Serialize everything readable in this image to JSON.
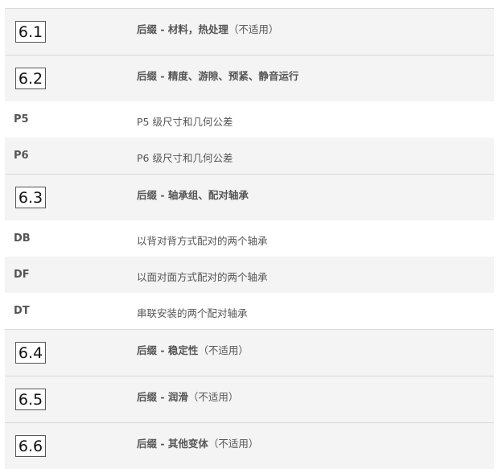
{
  "rows": [
    {
      "type": "section",
      "number": "6.1",
      "title": "后缀 - 材料，热处理",
      "note": "（不适用）"
    },
    {
      "type": "section",
      "number": "6.2",
      "title": "后缀 - 精度、游隙、预紧、静音运行",
      "note": ""
    },
    {
      "type": "item",
      "code": "P5",
      "desc": "P5 级尺寸和几何公差"
    },
    {
      "type": "item",
      "code": "P6",
      "desc": "P6 级尺寸和几何公差"
    },
    {
      "type": "section",
      "number": "6.3",
      "title": "后缀 - 轴承组、配对轴承",
      "note": ""
    },
    {
      "type": "item",
      "code": "DB",
      "desc": "以背对背方式配对的两个轴承"
    },
    {
      "type": "item",
      "code": "DF",
      "desc": "以面对面方式配对的两个轴承"
    },
    {
      "type": "item",
      "code": "DT",
      "desc": "串联安装的两个配对轴承"
    },
    {
      "type": "section",
      "number": "6.4",
      "title": "后缀 - 稳定性",
      "note": "（不适用）"
    },
    {
      "type": "section",
      "number": "6.5",
      "title": "后缀 - 润滑",
      "note": "（不适用）"
    },
    {
      "type": "section",
      "number": "6.6",
      "title": "后缀 - 其他变体",
      "note": "（不适用）"
    }
  ]
}
